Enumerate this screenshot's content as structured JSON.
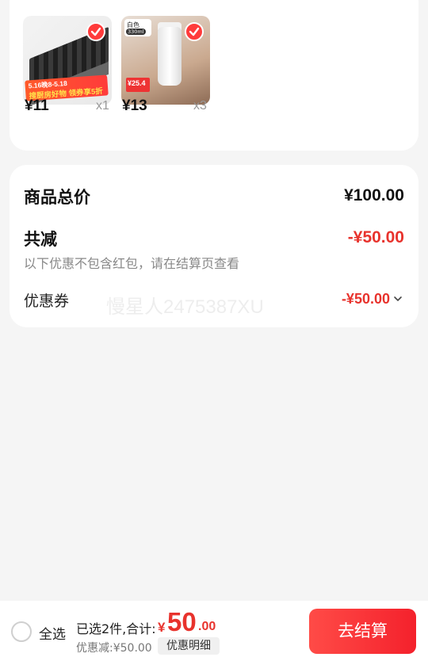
{
  "products": [
    {
      "price": "¥11",
      "qty": "x1",
      "promo_line1": "5.16晚8-5.18",
      "promo_line2": "搜厨房好物 领券享5折"
    },
    {
      "price": "¥13",
      "qty": "x3",
      "tag_color": "白色",
      "tag_size": "330ml",
      "badge_price": "¥25.4"
    }
  ],
  "summary": {
    "total_label": "商品总价",
    "total_value": "¥100.00",
    "discount_label": "共减",
    "discount_value": "-¥50.00",
    "discount_note": "以下优惠不包含红包，请在结算页查看",
    "coupon_label": "优惠券",
    "coupon_value": "-¥50.00",
    "watermark": "慢星人2475387XU"
  },
  "bottom_bar": {
    "select_all_label": "全选",
    "selected_text": "已选2件,合计:",
    "currency": "¥",
    "total_int": "50",
    "total_dec": ".00",
    "discount_text": "优惠减:¥50.00",
    "detail_button": "优惠明细",
    "checkout_button": "去结算"
  },
  "colors": {
    "accent": "#e8332d",
    "checkout": "#f4212c"
  }
}
